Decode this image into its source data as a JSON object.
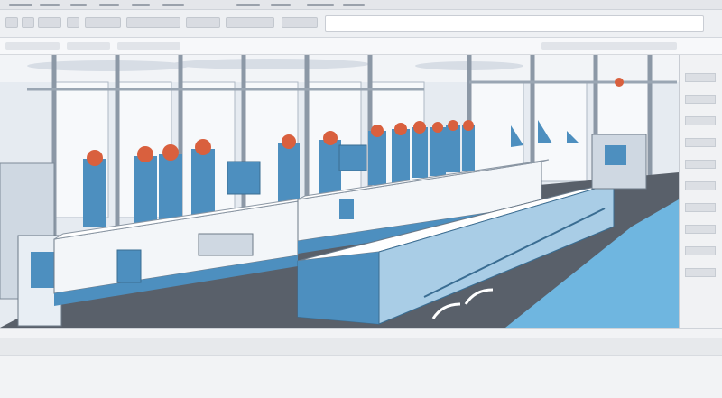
{
  "app": {
    "title": "",
    "colors": {
      "accent": "#5aa6d6",
      "floor_blue": "#6fb6e0",
      "machine_blue": "#4d8fbf",
      "worker_orange": "#d9603e",
      "panel_gray": "#f1f2f4"
    }
  },
  "toolbar": {
    "items": [
      "menu",
      "edit",
      "view",
      "insert",
      "tools",
      "window",
      "help"
    ],
    "address": ""
  },
  "tabs": {
    "items": [
      "tab-1",
      "tab-2",
      "tab-3"
    ]
  },
  "viewport": {
    "scene": "factory-assembly-line",
    "icon": "factory-illustration"
  },
  "right_panel": {
    "items": [
      "item-1",
      "item-2",
      "item-3",
      "item-4",
      "item-5",
      "item-6",
      "item-7",
      "item-8"
    ]
  },
  "status": {
    "text": ""
  }
}
